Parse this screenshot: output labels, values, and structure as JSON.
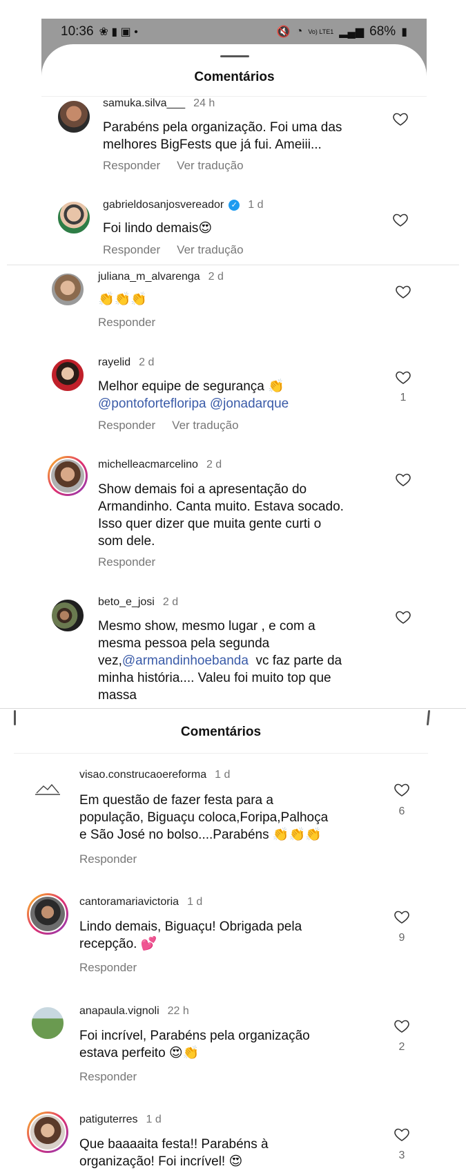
{
  "status_bar": {
    "time": "10:36",
    "icons_left": "❀ ▮ ▣ •",
    "network": "Vo) LTE1",
    "battery": "68%"
  },
  "sheet_title": "Comentários",
  "actions": {
    "reply": "Responder",
    "translate": "Ver tradução"
  },
  "comments": [
    {
      "username": "samuka.silva___",
      "time": "24 h",
      "line1": "Parabéns pela organização. Foi uma das",
      "line2": "melhores BigFests que já fui. Ameiii..."
    },
    {
      "username": "gabrieldosanjosvereador",
      "time": "1 d",
      "line1": "Foi lindo demais😍"
    },
    {
      "username": "juliana_m_alvarenga",
      "time": "2 d",
      "line1": "👏👏👏"
    },
    {
      "username": "rayelid",
      "time": "2 d",
      "line1": "Melhor equipe de segurança 👏",
      "mentions": "@pontofortefloripa @jonadarque",
      "likes": "1"
    },
    {
      "username": "michelleacmarcelino",
      "time": "2 d",
      "line1": "Show demais foi a apresentação do",
      "line2": "Armandinho. Canta muito. Estava socado.",
      "line3": "Isso quer dizer que muita gente curti o",
      "line4": "som dele."
    },
    {
      "username": "beto_e_josi",
      "time": "2 d",
      "line1": "Mesmo show, mesmo lugar , e  com a",
      "line2": "mesma pessoa pela segunda",
      "line3_pre": "vez,",
      "line3_mention": "@armandinhoebanda",
      "line3_post": "  vc faz parte da",
      "line4": "minha história.... Valeu foi muito top que",
      "line5": "massa"
    },
    {
      "username": "visao.construcaoereforma",
      "time": "1 d",
      "line1": "Em questão de fazer festa para a",
      "line2": "população, Biguaçu coloca,Foripa,Palhoça",
      "line3": "e São José no bolso....Parabéns 👏👏👏",
      "likes": "6"
    },
    {
      "username": "cantoramariavictoria",
      "time": "1 d",
      "line1": "Lindo demais, Biguaçu! Obrigada pela",
      "line2": "recepção. 💕",
      "likes": "9"
    },
    {
      "username": "anapaula.vignoli",
      "time": "22 h",
      "line1": "Foi incrível, Parabéns pela organização",
      "line2": "estava perfeito 😍👏",
      "likes": "2"
    },
    {
      "username": "patiguterres",
      "time": "1 d",
      "line1": "Que baaaaita festa!! Parabéns à",
      "line2": "organização! Foi incrível! 😍",
      "likes": "3"
    }
  ],
  "colors": {
    "mention": "#3a5ba8",
    "verified": "#1d9bf0",
    "muted": "#777777",
    "story_ring": "#e1306c"
  }
}
